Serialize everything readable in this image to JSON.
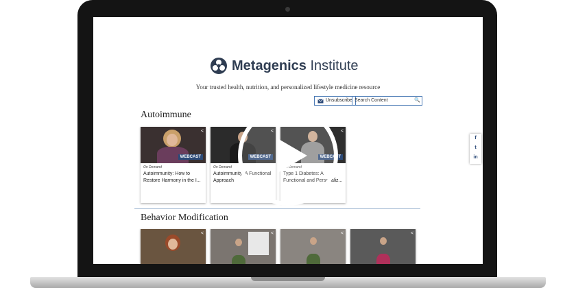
{
  "brand": {
    "name_bold": "Metagenics",
    "name_regular": " Institute"
  },
  "tagline": "Your trusted health, nutrition, and personalized lifestyle medicine resource",
  "unsubscribe_label": "Unsubscribe",
  "search": {
    "placeholder": "Search Content"
  },
  "sections": [
    {
      "title": "Autoimmune",
      "cards": [
        {
          "badge": "WEBCAST",
          "ondemand": "On Demand",
          "title": "Autoimmunity: How to Restore Harmony in the I..."
        },
        {
          "badge": "WEBCAST",
          "ondemand": "On Demand",
          "title": "Autoimmunity: A Functional Approach"
        },
        {
          "badge": "WEBCAST",
          "ondemand": "On Demand",
          "title": "Type 1 Diabetes: A Functional and Personaliz..."
        }
      ]
    },
    {
      "title": "Behavior Modification"
    }
  ],
  "social": {
    "facebook": "f",
    "twitter": "t",
    "linkedin": "in"
  },
  "icons": {
    "play": "play-icon",
    "share": "share-icon",
    "search": "search-icon",
    "email": "email-icon"
  }
}
